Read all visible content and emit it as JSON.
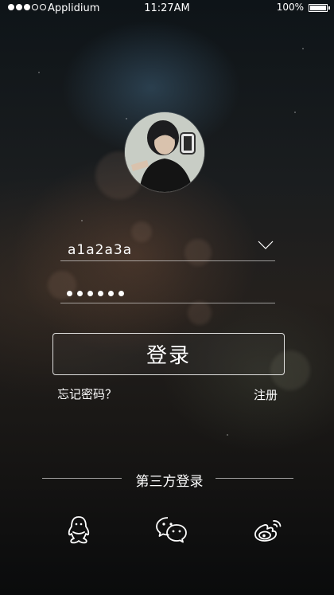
{
  "status_bar": {
    "carrier": "Applidium",
    "time": "11:27AM",
    "battery": "100%",
    "signal_bars_filled": 3,
    "signal_bars_total": 5
  },
  "avatar": {
    "icon": "user-avatar-icon"
  },
  "login_form": {
    "username_value": "a1a2a3a",
    "password_masked_count": 6,
    "dropdown_icon": "chevron-down-icon",
    "login_label": "登录",
    "forgot_label": "忘记密码？",
    "register_label": "注册"
  },
  "third_party": {
    "title": "第三方登录",
    "providers": [
      {
        "name": "qq",
        "icon": "qq-icon"
      },
      {
        "name": "wechat",
        "icon": "wechat-icon"
      },
      {
        "name": "weibo",
        "icon": "weibo-icon"
      }
    ]
  },
  "colors": {
    "text": "#ffffff",
    "background": "#14171a"
  }
}
